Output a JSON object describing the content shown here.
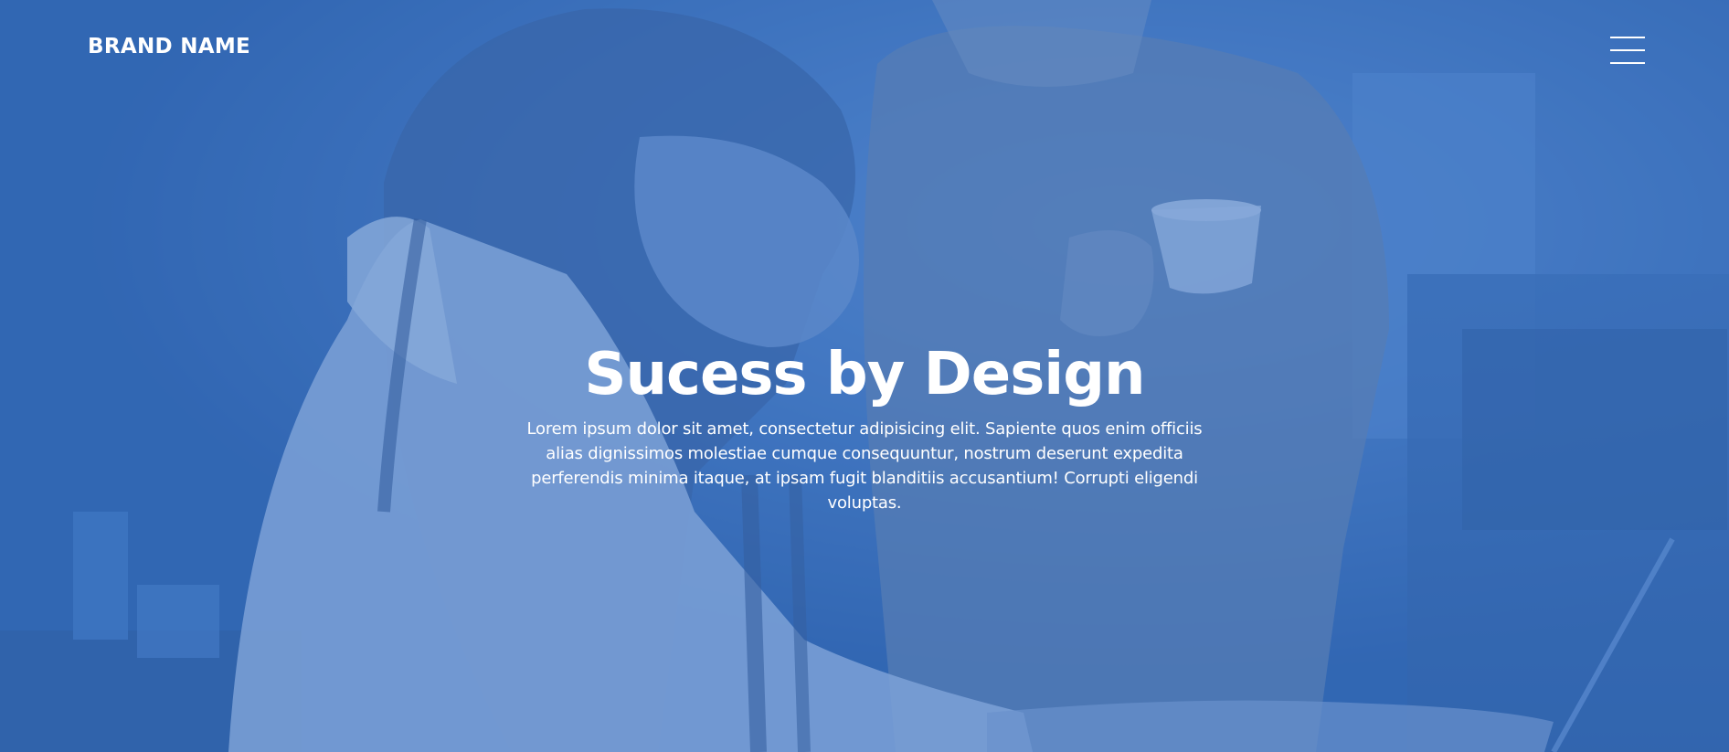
{
  "navbar": {
    "brand": "BRAND NAME",
    "menu_icon": "hamburger-menu-icon"
  },
  "hero": {
    "title": "Sucess by Design",
    "subtitle": "Lorem ipsum dolor sit amet, consectetur adipisicing elit. Sapiente quos enim officiis alias dignissimos molestiae cumque consequuntur, nostrum deserunt expedita perferendis minima itaque, at ipsam fugit blanditiis accusantium! Corrupti eligendi voluptas.",
    "overlay_color": "#346ebe",
    "text_color": "#ffffff"
  }
}
